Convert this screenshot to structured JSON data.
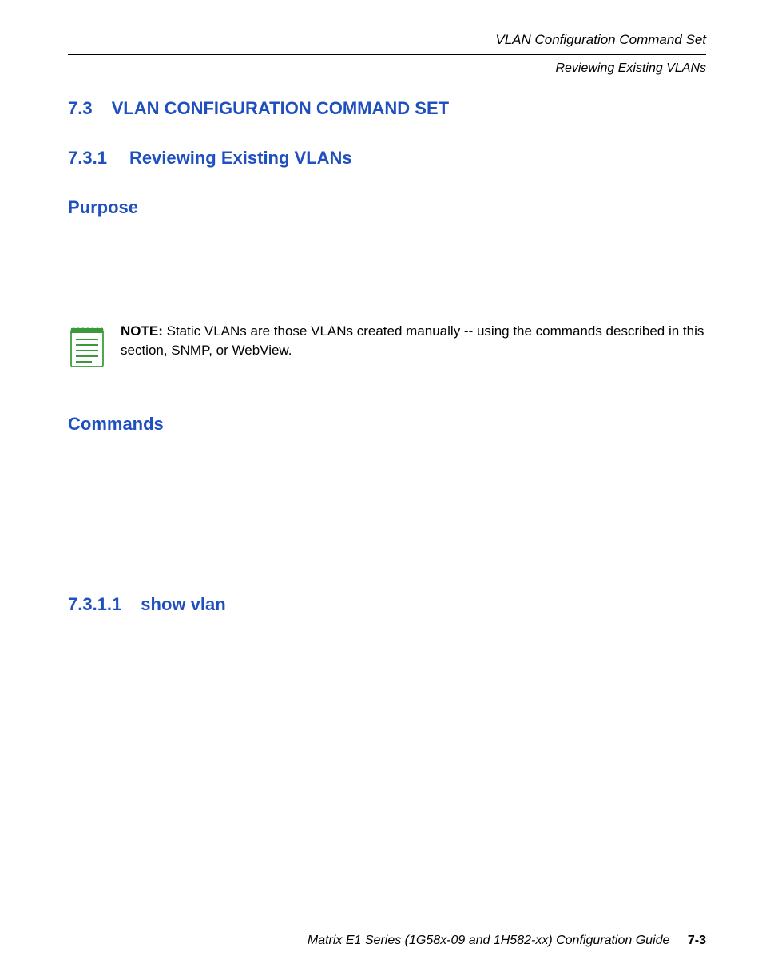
{
  "header": {
    "title": "VLAN Configuration Command Set",
    "subtitle": "Reviewing Existing VLANs"
  },
  "section_main": {
    "number": "7.3",
    "title": "VLAN CONFIGURATION COMMAND SET"
  },
  "section_sub": {
    "number": "7.3.1",
    "title": "Reviewing Existing VLANs"
  },
  "purpose_heading": "Purpose",
  "note": {
    "label": "NOTE:",
    "text": "Static VLANs are those VLANs created manually -- using the commands described in this section, SNMP, or WebView."
  },
  "commands_heading": "Commands",
  "section_cmd": {
    "number": "7.3.1.1",
    "title": "show vlan"
  },
  "footer": {
    "text": "Matrix E1 Series (1G58x-09 and 1H582-xx) Configuration Guide",
    "pagenum": "7-3"
  }
}
